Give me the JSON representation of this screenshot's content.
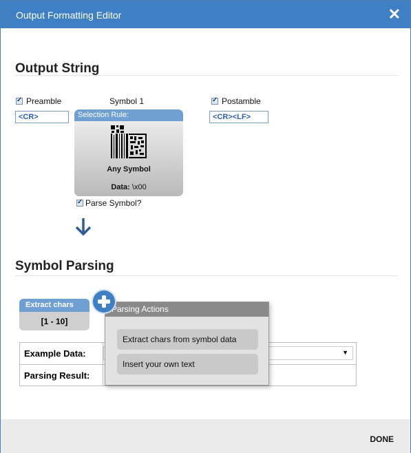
{
  "window": {
    "title": "Output Formatting Editor",
    "close_glyph": "✕"
  },
  "output_string": {
    "heading": "Output String",
    "preamble": {
      "label": "Preamble",
      "checked": true,
      "value": "<CR>"
    },
    "symbol": {
      "label": "Symbol 1",
      "card_header": "Selection Rule:",
      "icon": "datamatrix-barcode-icon",
      "name": "Any Symbol",
      "data_label": "Data:",
      "data_value": "\\x00"
    },
    "postamble": {
      "label": "Postamble",
      "checked": true,
      "value": "<CR><LF>"
    },
    "parse_symbol": {
      "label": "Parse Symbol?",
      "checked": true
    },
    "arrow_icon": "arrow-down-icon"
  },
  "symbol_parsing": {
    "heading": "Symbol Parsing",
    "extract_block": {
      "title": "Extract chars",
      "range": "[1 - 10]"
    },
    "add_icon": "plus-circle-icon",
    "example_data_label": "Example Data:",
    "parsing_result_label": "Parsing Result:",
    "example_data_value": ""
  },
  "parsing_actions": {
    "title": "Parsing Actions",
    "items": [
      "Extract chars from symbol data",
      "Insert your own text"
    ]
  },
  "footer": {
    "done_label": "DONE"
  },
  "colors": {
    "accent": "#3f7fc4",
    "header_blue": "#6f9fd3",
    "field_text": "#2b5fb0"
  }
}
